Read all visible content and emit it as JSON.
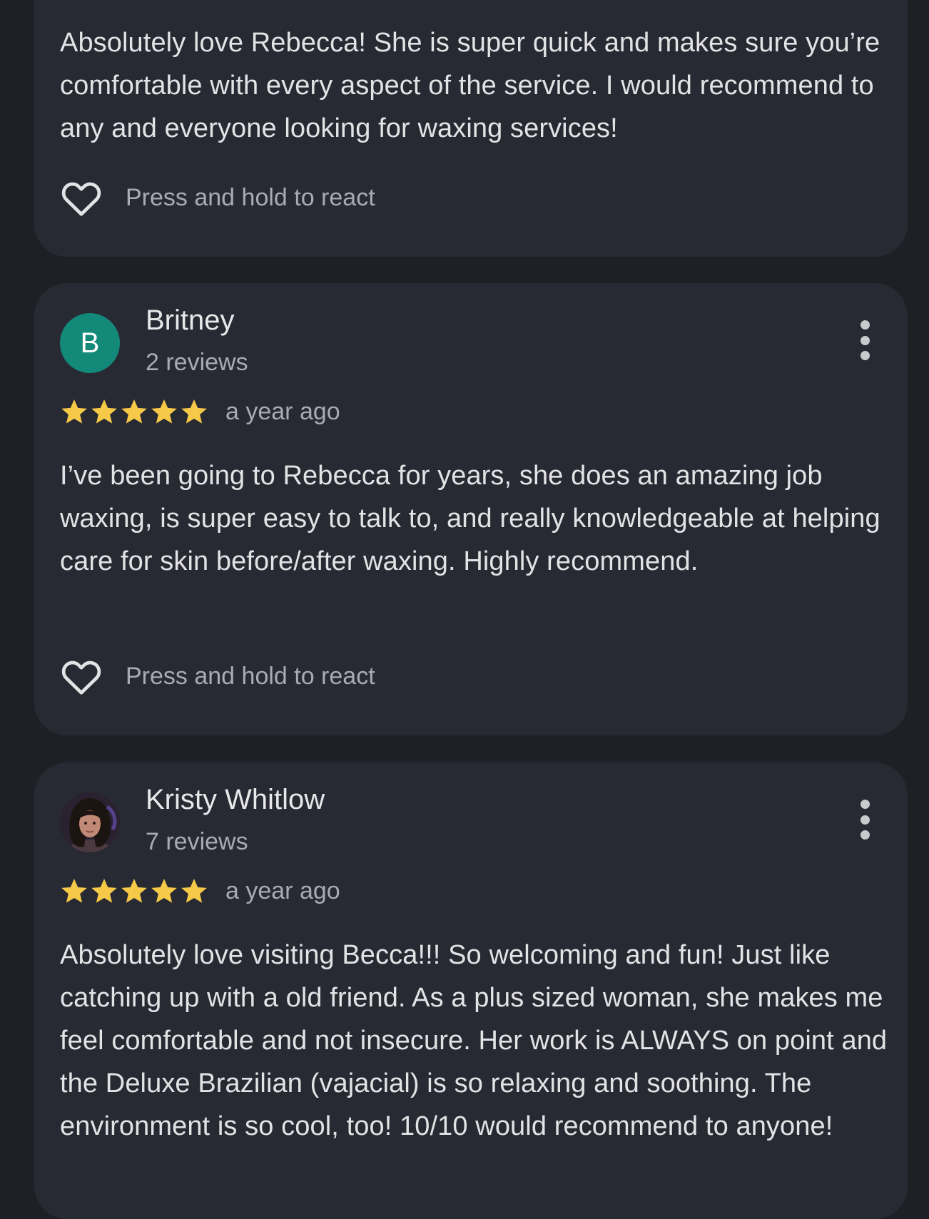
{
  "colors": {
    "background": "#1f2025",
    "card": "#282a33",
    "star": "#f7c948",
    "avatar_letter_bg": "#13897a",
    "secondary_text": "#a9abb2"
  },
  "reviews": [
    {
      "text": "Absolutely love Rebecca! She is super quick and makes sure you’re comfortable with every aspect of the service. I would recommend to any and everyone looking for waxing services!",
      "react_label": "Press and hold to react",
      "react_icon": "heart-outline-icon"
    },
    {
      "avatar_letter": "B",
      "name": "Britney",
      "review_count": "2 reviews",
      "rating": 5,
      "date": "a year ago",
      "text": "I’ve been going to Rebecca for years, she does an amazing job waxing, is super easy to talk to, and really knowledgeable at helping care for skin before/after waxing. Highly recommend.",
      "react_label": "Press and hold to react",
      "react_icon": "heart-outline-icon",
      "more_icon": "more-vert-icon"
    },
    {
      "avatar_icon": "profile-photo",
      "name": "Kristy Whitlow",
      "review_count": "7 reviews",
      "rating": 5,
      "date": "a year ago",
      "text": "Absolutely love visiting Becca!!! So welcoming and fun! Just like catching up with a old friend. As a plus sized woman, she makes me feel comfortable and not insecure. Her work is ALWAYS on point and the Deluxe Brazilian (vajacial) is so relaxing and soothing. The environment is so cool, too! 10/10 would recommend to anyone!",
      "more_icon": "more-vert-icon"
    }
  ]
}
